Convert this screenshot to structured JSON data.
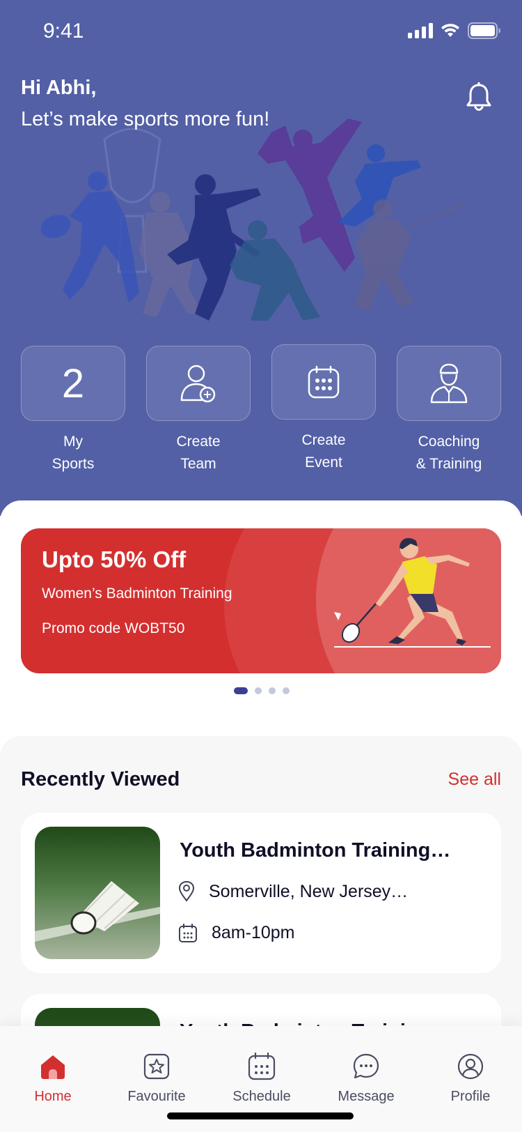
{
  "status": {
    "time": "9:41"
  },
  "header": {
    "greeting": "Hi Abhi,",
    "tagline": "Let’s make sports more fun!",
    "notification_icon": "bell-icon"
  },
  "quick_actions": [
    {
      "id": "my-sports",
      "value": "2",
      "label": "My\nSports"
    },
    {
      "id": "create-team",
      "icon": "add-user-icon",
      "label": "Create\nTeam"
    },
    {
      "id": "create-event",
      "icon": "calendar-icon",
      "label": "Create\nEvent"
    },
    {
      "id": "coaching",
      "icon": "coach-icon",
      "label": "Coaching\n& Training"
    }
  ],
  "promo": {
    "title": "Upto 50% Off",
    "subtitle": "Women’s Badminton Training",
    "code": "Promo code WOBT50",
    "slides": 4,
    "active_slide": 0
  },
  "recent": {
    "title": "Recently Viewed",
    "see_all": "See all",
    "items": [
      {
        "title": "Youth Badminton Training…",
        "location": "Somerville, New Jersey…",
        "time": "8am-10pm"
      },
      {
        "title": "Youth Badminton Training…",
        "location": "",
        "time": ""
      }
    ]
  },
  "tabbar": {
    "active": "home",
    "tabs": [
      {
        "id": "home",
        "label": "Home",
        "icon": "home-icon"
      },
      {
        "id": "favourite",
        "label": "Favourite",
        "icon": "star-icon"
      },
      {
        "id": "schedule",
        "label": "Schedule",
        "icon": "calendar-icon"
      },
      {
        "id": "message",
        "label": "Message",
        "icon": "chat-icon"
      },
      {
        "id": "profile",
        "label": "Profile",
        "icon": "profile-icon"
      }
    ]
  },
  "colors": {
    "brand": "#5360a6",
    "accent": "#d32f2f",
    "dot_active": "#3a3f95"
  }
}
